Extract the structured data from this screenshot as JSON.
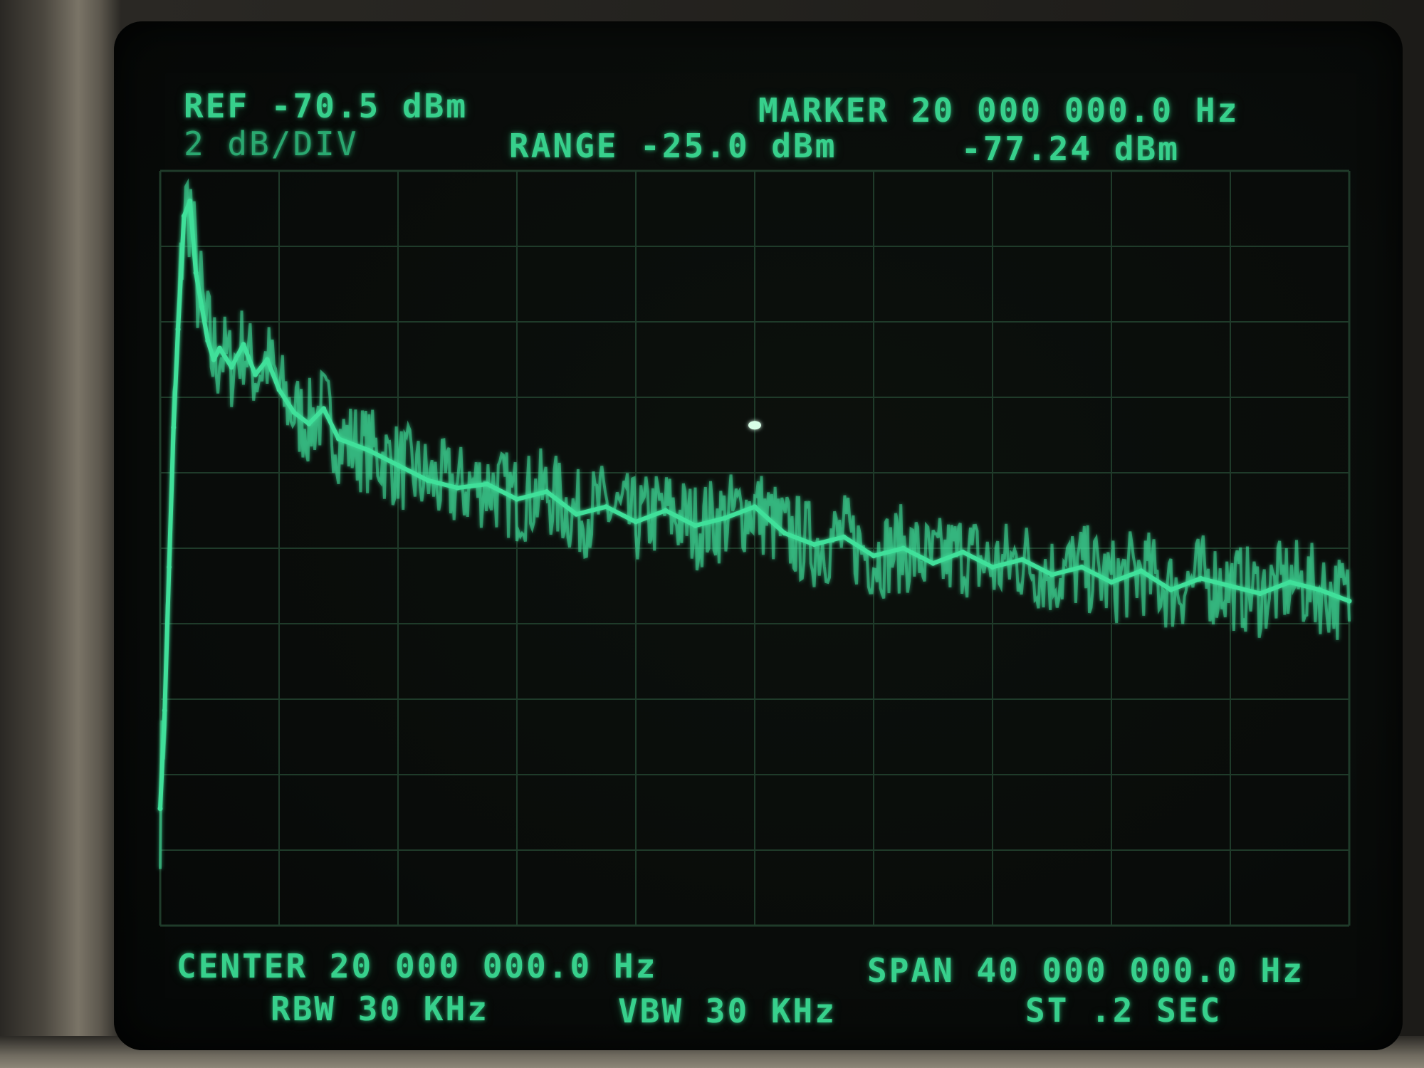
{
  "header": {
    "ref": "REF -70.5 dBm",
    "marker_freq": "MARKER 20 000 000.0 Hz",
    "scale": "2 dB/DIV",
    "range": "RANGE -25.0 dBm",
    "marker_level": "-77.24 dBm"
  },
  "footer": {
    "center": "CENTER 20 000 000.0 Hz",
    "span": "SPAN 40 000 000.0 Hz",
    "rbw": "RBW 30 KHz",
    "vbw": "VBW 30 KHz",
    "sweep": "ST .2 SEC"
  },
  "colors": {
    "trace": "#3fe09a",
    "graticule": "#1f3b2a",
    "text": "#37d08c"
  },
  "chart_data": {
    "type": "line",
    "title": "",
    "xlabel": "",
    "ylabel": "",
    "x_unit": "MHz",
    "y_unit": "dBm",
    "xlim": [
      0,
      40
    ],
    "ylim": [
      -90.5,
      -70.5
    ],
    "grid": true,
    "marker": {
      "x": 20,
      "y": -77.24
    },
    "series": [
      {
        "x": [
          0,
          0.15,
          0.3,
          0.45,
          0.6,
          0.8,
          1.0,
          1.2,
          1.4,
          1.6,
          1.8,
          2.0,
          2.4,
          2.8,
          3.2,
          3.6,
          4.0,
          4.5,
          5.0,
          5.5,
          6.0,
          7.0,
          8.0,
          9.0,
          10.0,
          11.0,
          12.0,
          13.0,
          14.0,
          15.0,
          16.0,
          17.0,
          18.0,
          19.0,
          20.0,
          21.0,
          22.0,
          23.0,
          24.0,
          25.0,
          26.0,
          27.0,
          28.0,
          29.0,
          30.0,
          31.0,
          32.0,
          33.0,
          34.0,
          35.0,
          36.0,
          37.0,
          38.0,
          39.0,
          40.0
        ],
        "y": [
          -87.4,
          -84.8,
          -81.0,
          -77.3,
          -74.7,
          -71.7,
          -71.3,
          -73.2,
          -74.1,
          -75.0,
          -75.5,
          -75.2,
          -75.7,
          -75.1,
          -75.9,
          -75.5,
          -76.3,
          -76.9,
          -77.2,
          -76.8,
          -77.6,
          -77.9,
          -78.3,
          -78.7,
          -78.9,
          -78.8,
          -79.2,
          -79.0,
          -79.6,
          -79.4,
          -79.8,
          -79.5,
          -79.9,
          -79.7,
          -79.4,
          -80.1,
          -80.4,
          -80.2,
          -80.7,
          -80.5,
          -80.9,
          -80.6,
          -81.0,
          -80.8,
          -81.2,
          -81.0,
          -81.4,
          -81.1,
          -81.6,
          -81.3,
          -81.5,
          -81.7,
          -81.4,
          -81.6,
          -81.9
        ]
      }
    ]
  }
}
